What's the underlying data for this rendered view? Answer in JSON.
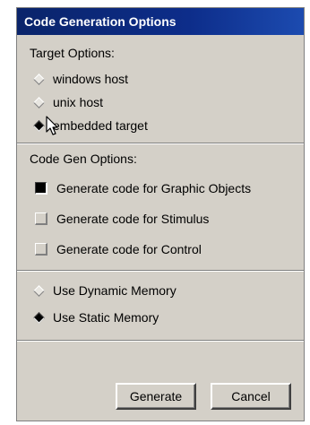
{
  "dialog": {
    "title": "Code Generation Options"
  },
  "target_options": {
    "label": "Target Options:",
    "items": [
      {
        "label": "windows host",
        "selected": false
      },
      {
        "label": "unix host",
        "selected": false
      },
      {
        "label": "embedded target",
        "selected": true
      }
    ]
  },
  "codegen_options": {
    "label": "Code Gen Options:",
    "items": [
      {
        "label": "Generate code for Graphic Objects",
        "checked": true
      },
      {
        "label": "Generate code for Stimulus",
        "checked": false
      },
      {
        "label": "Generate code for Control",
        "checked": false
      }
    ]
  },
  "memory_options": {
    "items": [
      {
        "label": "Use Dynamic Memory",
        "selected": false
      },
      {
        "label": "Use Static Memory",
        "selected": true
      }
    ]
  },
  "buttons": {
    "generate": "Generate",
    "cancel": "Cancel"
  },
  "icons": {
    "cursor": "arrow-cursor-icon"
  },
  "colors": {
    "title_bar": "#0a246a",
    "face": "#d4d0c8"
  }
}
